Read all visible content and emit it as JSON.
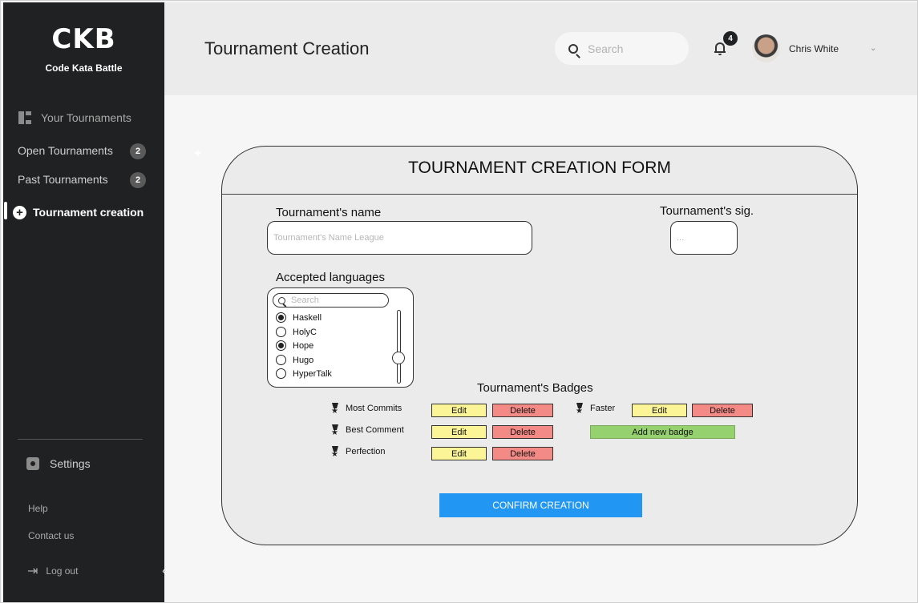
{
  "brand": {
    "logo": "CKB",
    "subtitle": "Code Kata Battle"
  },
  "sidebar": {
    "section_title": "Your Tournaments",
    "items": [
      {
        "label": "Open Tournaments",
        "count": "2"
      },
      {
        "label": "Past Tournaments",
        "count": "2"
      }
    ],
    "active_item": "Tournament creation",
    "settings": "Settings",
    "help": "Help",
    "contact": "Contact us",
    "logout": "Log out"
  },
  "header": {
    "title": "Tournament Creation",
    "search_placeholder": "Search",
    "notifications": "4",
    "user_name": "Chris White"
  },
  "form": {
    "title": "TOURNAMENT CREATION FORM",
    "name_label": "Tournament's name",
    "name_placeholder": "Tournament's Name League",
    "sig_label": "Tournament's sig.",
    "sig_placeholder": "...",
    "languages_label": "Accepted languages",
    "languages_search_placeholder": "Search",
    "languages": [
      {
        "name": "Haskell",
        "selected": true
      },
      {
        "name": "HolyC",
        "selected": false
      },
      {
        "name": "Hope",
        "selected": true
      },
      {
        "name": "Hugo",
        "selected": false
      },
      {
        "name": "HyperTalk",
        "selected": false
      }
    ],
    "badges_label": "Tournament's Badges",
    "badges": [
      {
        "name": "Most Commits"
      },
      {
        "name": "Best Comment"
      },
      {
        "name": "Perfection"
      },
      {
        "name": "Faster"
      }
    ],
    "edit_label": "Edit",
    "delete_label": "Delete",
    "add_badge_label": "Add new badge",
    "confirm_label": "CONFIRM CREATION"
  },
  "colors": {
    "sidebar_bg": "#202122",
    "edit_button": "#fbf598",
    "delete_button": "#f48a85",
    "add_button": "#95d16e",
    "confirm_button": "#2196f3"
  }
}
